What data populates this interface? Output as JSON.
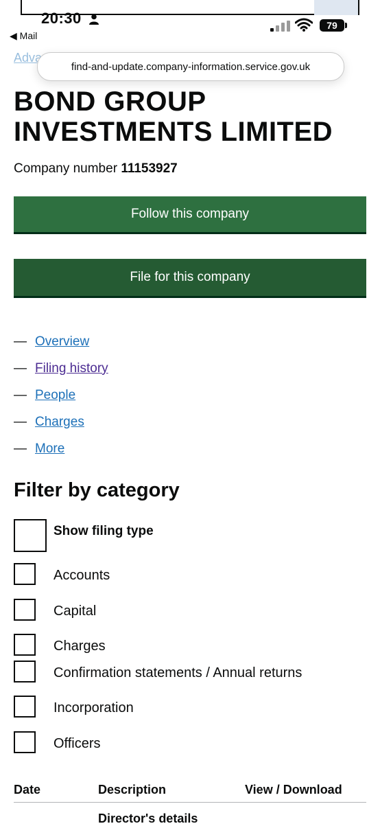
{
  "status_bar": {
    "time": "20:30",
    "back_label": "Mail",
    "battery": "79"
  },
  "browser": {
    "url": "find-and-update.company-information.service.gov.uk",
    "breadcrumb_partial": "Advanced company search"
  },
  "company": {
    "name": "BOND GROUP INVESTMENTS LIMITED",
    "number_label": "Company number",
    "number": "11153927"
  },
  "buttons": {
    "follow": "Follow this company",
    "file": "File for this company"
  },
  "nav": [
    {
      "label": "Overview"
    },
    {
      "label": "Filing history"
    },
    {
      "label": "People"
    },
    {
      "label": "Charges"
    },
    {
      "label": "More"
    }
  ],
  "filter": {
    "heading": "Filter by category",
    "show_filing_type": "Show filing type",
    "categories": [
      "Accounts",
      "Capital",
      "Charges",
      "Confirmation statements / Annual returns",
      "Incorporation",
      "Officers"
    ]
  },
  "table": {
    "headers": [
      "Date",
      "Description",
      "View / Download"
    ],
    "first_row_description": "Director's details"
  },
  "colors": {
    "button_green": "#2e7040",
    "button_green_dark": "#255b33",
    "link_blue": "#1d70b8",
    "link_visited": "#4c2c92"
  }
}
